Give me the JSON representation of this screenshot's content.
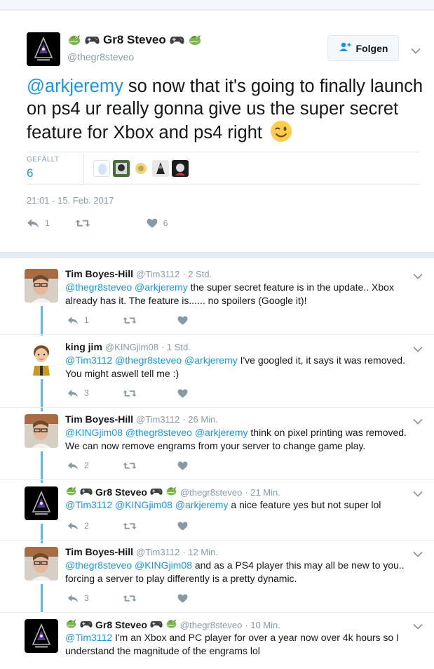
{
  "main_tweet": {
    "display_name": "Gr8 Steveo",
    "handle": "@thegr8steveo",
    "follow_label": "Folgen",
    "text_mention": "@arkjeremy",
    "text_body": " so now that it's going to finally launch on ps4 ur really gonna give us the super secret feature for Xbox and ps4 right",
    "likes_label": "GEFÄLLT",
    "likes_count": "6",
    "timestamp": "21:01 - 15. Feb. 2017",
    "reply_count": "1",
    "retweet_count": "",
    "like_count": "6"
  },
  "replies": [
    {
      "name": "Tim Boyes-Hill",
      "handle": "@Tim3112",
      "time": "· 2 Std.",
      "mentions": "@thegr8steveo @arkjeremy",
      "text": " the super secret feature is in the update.. Xbox already has it. The feature is...... no spoilers (Google it)!",
      "reply_count": "1",
      "like_count": ""
    },
    {
      "name": "king jim",
      "handle": "@KINGjim08",
      "time": "· 1 Std.",
      "mentions": "@Tim3112 @thegr8steveo @arkjeremy",
      "text": " I've googled it, it says it was removed. You might aswell tell me :)",
      "reply_count": "3",
      "like_count": ""
    },
    {
      "name": "Tim Boyes-Hill",
      "handle": "@Tim3112",
      "time": "· 26 Min.",
      "mentions": "@KINGjim08 @thegr8steveo @arkjeremy",
      "text": " think on pixel printing was removed. We can now remove engrams from your server to change game play.",
      "reply_count": "2",
      "like_count": ""
    },
    {
      "name": "Gr8 Steveo",
      "handle": "@thegr8steveo",
      "time": "· 21 Min.",
      "mentions": "@Tim3112 @KINGjim08 @arkjeremy",
      "text": " a nice feature yes but not super lol",
      "reply_count": "2",
      "like_count": ""
    },
    {
      "name": "Tim Boyes-Hill",
      "handle": "@Tim3112",
      "time": "· 12 Min.",
      "mentions": "@thegr8steveo @KINGjim08",
      "text": " and as a PS4 player this may all be new to you.. forcing a server to play differently is a pretty dynamic.",
      "reply_count": "3",
      "like_count": ""
    },
    {
      "name": "Gr8 Steveo",
      "handle": "@thegr8steveo",
      "time": "· 10 Min.",
      "mentions": "@Tim3112",
      "text": " I'm an Xbox and PC player for over a year now over 4k hours so I understand the magnitude of the engrams lol",
      "reply_count": "",
      "like_count": ""
    }
  ],
  "colors": {
    "link": "#1b95e0",
    "muted": "#8899a6",
    "thread": "#6ab4e0"
  },
  "icons": [
    "reply-icon",
    "retweet-icon",
    "heart-icon",
    "chevron-down-icon",
    "follow-user-icon",
    "crocodile-emoji-icon",
    "gamepad-emoji-icon",
    "wink-emoji-icon"
  ]
}
